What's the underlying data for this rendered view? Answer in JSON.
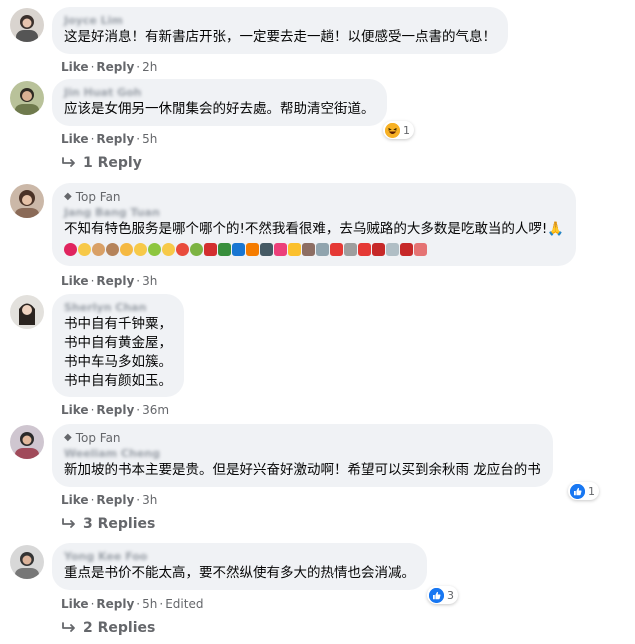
{
  "comments": [
    {
      "author": "Joyce Lim",
      "badge": "",
      "lines": [
        "这是好消息！有新書店开张，一定要去走一趟！以便感受一点書的气息！"
      ],
      "actions": {
        "like": "Like",
        "reply": "Reply",
        "time": "2h",
        "edited": ""
      },
      "reactions": null,
      "replies_label": ""
    },
    {
      "author": "Jin Huat Goh",
      "badge": "",
      "lines": [
        "应该是女佣另一休閒集会的好去處。帮助清空街道。"
      ],
      "actions": {
        "like": "Like",
        "reply": "Reply",
        "time": "5h",
        "edited": ""
      },
      "reactions": {
        "type": "haha",
        "count": "1"
      },
      "replies_label": "1 Reply"
    },
    {
      "author": "Jang Bang Tuan",
      "badge": "Top Fan",
      "lines": [
        "不知有特色服务是哪个哪个的!不然我看很难，去乌贼路的大多数是吃敢当的人啰!🙏"
      ],
      "actions": {
        "like": "Like",
        "reply": "Reply",
        "time": "3h",
        "edited": ""
      },
      "reactions": null,
      "replies_label": ""
    },
    {
      "author": "Sherlyn Chan",
      "badge": "",
      "lines": [
        "书中自有千钟粟，",
        "书中自有黄金屋，",
        "书中车马多如簇。",
        "书中自有颜如玉。"
      ],
      "actions": {
        "like": "Like",
        "reply": "Reply",
        "time": "36m",
        "edited": ""
      },
      "reactions": null,
      "replies_label": ""
    },
    {
      "author": "Weeliam Cheng",
      "badge": "Top Fan",
      "lines": [
        "新加坡的书本主要是贵。但是好兴奋好激动啊！希望可以买到余秋雨 龙应台的书"
      ],
      "actions": {
        "like": "Like",
        "reply": "Reply",
        "time": "3h",
        "edited": ""
      },
      "reactions": {
        "type": "like",
        "count": "1"
      },
      "replies_label": "3 Replies"
    },
    {
      "author": "Yong Kee Foo",
      "badge": "",
      "lines": [
        "重点是书价不能太高，要不然纵使有多大的热情也会消减。"
      ],
      "actions": {
        "like": "Like",
        "reply": "Reply",
        "time": "5h",
        "edited": "Edited"
      },
      "reactions": {
        "type": "like",
        "count": "3"
      },
      "replies_label": "2 Replies"
    }
  ],
  "emoji_row": [
    "heart",
    "smile",
    "person",
    "monkey",
    "cat",
    "thumb",
    "sick",
    "worried",
    "clown",
    "money",
    "book-red",
    "book-green",
    "book-blue",
    "book-orange",
    "notebook",
    "book-pink",
    "book-yellow",
    "books",
    "book-open",
    "lantern",
    "church",
    "target",
    "gift",
    "tombstone",
    "flag",
    "cross"
  ],
  "icons": {
    "reply_arrow": "reply-arrow-icon",
    "gem": "diamond-icon"
  },
  "colors": {
    "bubble": "#f0f2f5",
    "meta": "#65676b",
    "like_blue": "#1877f2",
    "haha_yellow": "#f7b125"
  }
}
